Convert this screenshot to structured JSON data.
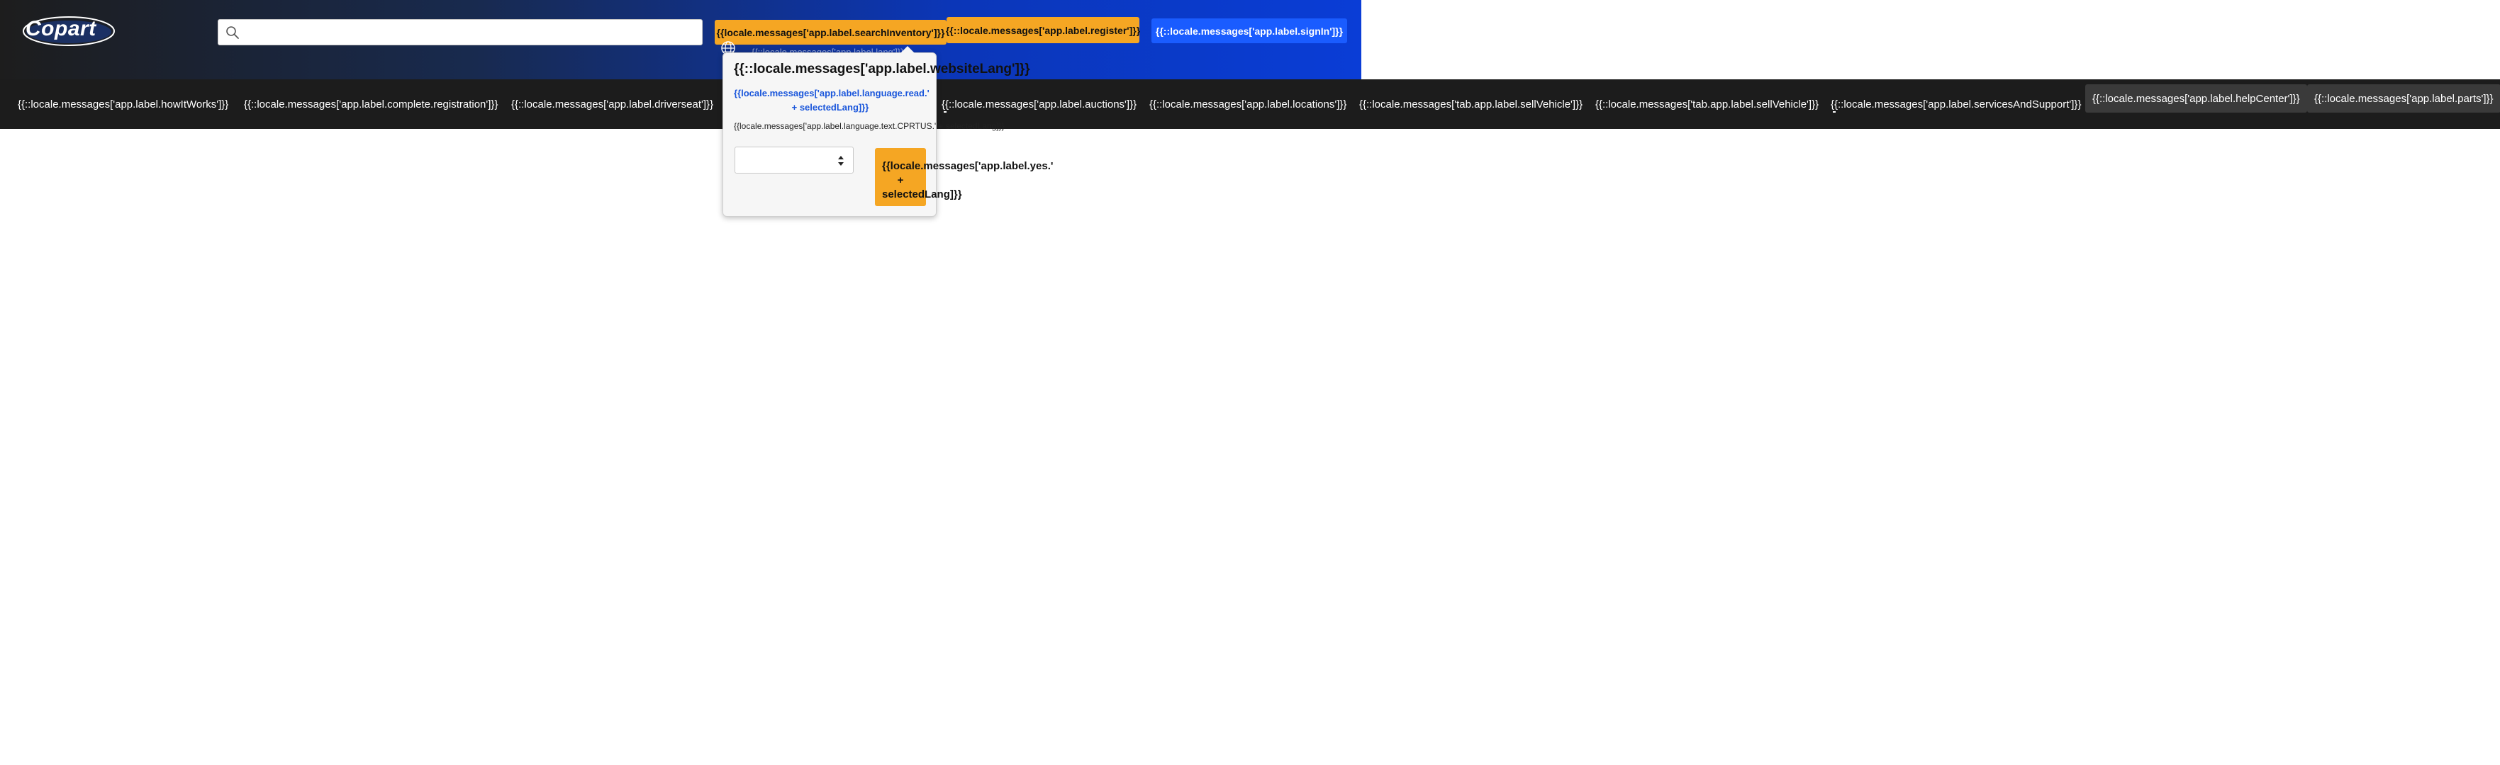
{
  "header": {
    "logo_text": "Copart",
    "search": {
      "placeholder": "",
      "value": ""
    },
    "search_inventory_label": "{{locale.messages['app.label.searchInventory']}}",
    "register_label": "{{::locale.messages['app.label.register']}}",
    "signin_label": "{{::locale.messages['app.label.signIn']}}",
    "lang_trigger_label": "{{::locale.messages['app.label.lang']}}"
  },
  "nav": {
    "items": [
      {
        "label": "{{::locale.messages['app.label.howItWorks']}}"
      },
      {
        "label": "{{::locale.messages['app.label.complete.registration']}}"
      },
      {
        "label": "{{::locale.messages['app.label.driverseat']}}"
      },
      {
        "label": "{{::locale.messages['app.label.auctions']}}"
      },
      {
        "label": "{{::locale.messages['app.label.locations']}}"
      },
      {
        "label": "{{::locale.messages['tab.app.label.sellVehicle']}}"
      },
      {
        "label": "{{::locale.messages['tab.app.label.sellVehicle']}}"
      },
      {
        "label": "{{::locale.messages['app.label.servicesAndSupport']}}"
      },
      {
        "label": "{{::locale.messages['app.label.helpCenter']}}"
      },
      {
        "label": "{{::locale.messages['app.label.parts']}}"
      }
    ]
  },
  "language_popover": {
    "title": "{{::locale.messages['app.label.websiteLang']}}",
    "read_line1": "{{locale.messages['app.label.language.read.'",
    "read_line2": "+ selectedLang]}}",
    "info_text": "{{locale.messages['app.label.language.text.CPRTUS.' + selectedLang]}}",
    "select_value": "",
    "yes_line1": "{{locale.messages['app.label.yes.'",
    "yes_line2": "+",
    "yes_line3": "selectedLang]}}"
  },
  "icons": {
    "search": "search-icon",
    "globe": "globe-icon",
    "select_arrows": "select-arrows-icon"
  },
  "colors": {
    "accent_yellow": "#f5a623",
    "signin_blue": "#1a5cff",
    "nav_background": "#1c1c1c",
    "link_blue": "#1a56db"
  }
}
